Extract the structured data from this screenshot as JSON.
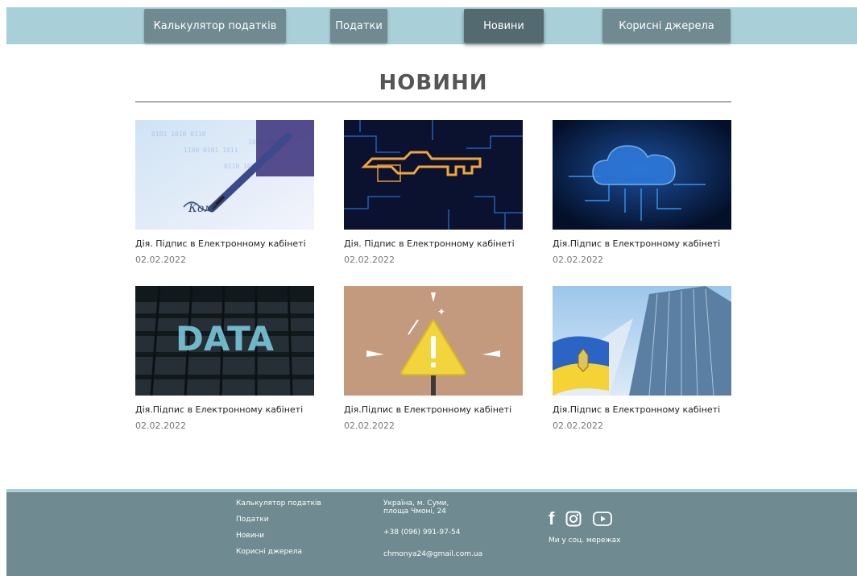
{
  "nav": {
    "items": [
      {
        "label": "Калькулятор податків"
      },
      {
        "label": "Податки"
      },
      {
        "label": "Новини"
      },
      {
        "label": "Корисні джерела"
      }
    ]
  },
  "page_title": "НОВИНИ",
  "news": [
    {
      "headline": "Дія. Підпис в Електронному кабінеті",
      "date": "02.02.2022"
    },
    {
      "headline": "Дія. Підпис в Електронному кабінеті",
      "date": "02.02.2022"
    },
    {
      "headline": "Дія.Підпис в Електронному кабінеті",
      "date": "02.02.2022"
    },
    {
      "headline": "Дія.Підпис в Електронному кабінеті",
      "date": "02.02.2022"
    },
    {
      "headline": "Дія.Підпис в Електронному кабінеті",
      "date": "02.02.2022"
    },
    {
      "headline": "Дія.Підпис в Електронному кабінеті",
      "date": "02.02.2022"
    }
  ],
  "footer": {
    "links": [
      "Калькулятор податків",
      "Податки",
      "Новини",
      "Корисні джерела"
    ],
    "address_line1": "Україна, м. Суми,",
    "address_line2": "площа Чмоні, 24",
    "phone": "+38 (096) 991-97-54",
    "email": "chmonya24@gmail.com.ua",
    "social_label": "Ми у соц. мережах"
  },
  "image_texts": {
    "pen_scribble": "Ком",
    "data_word": "DATA"
  },
  "colors": {
    "nav_bar": "#a9cfd9",
    "nav_button": "#6f8a91",
    "nav_button_active": "#536a70",
    "footer": "#6f8a91"
  }
}
